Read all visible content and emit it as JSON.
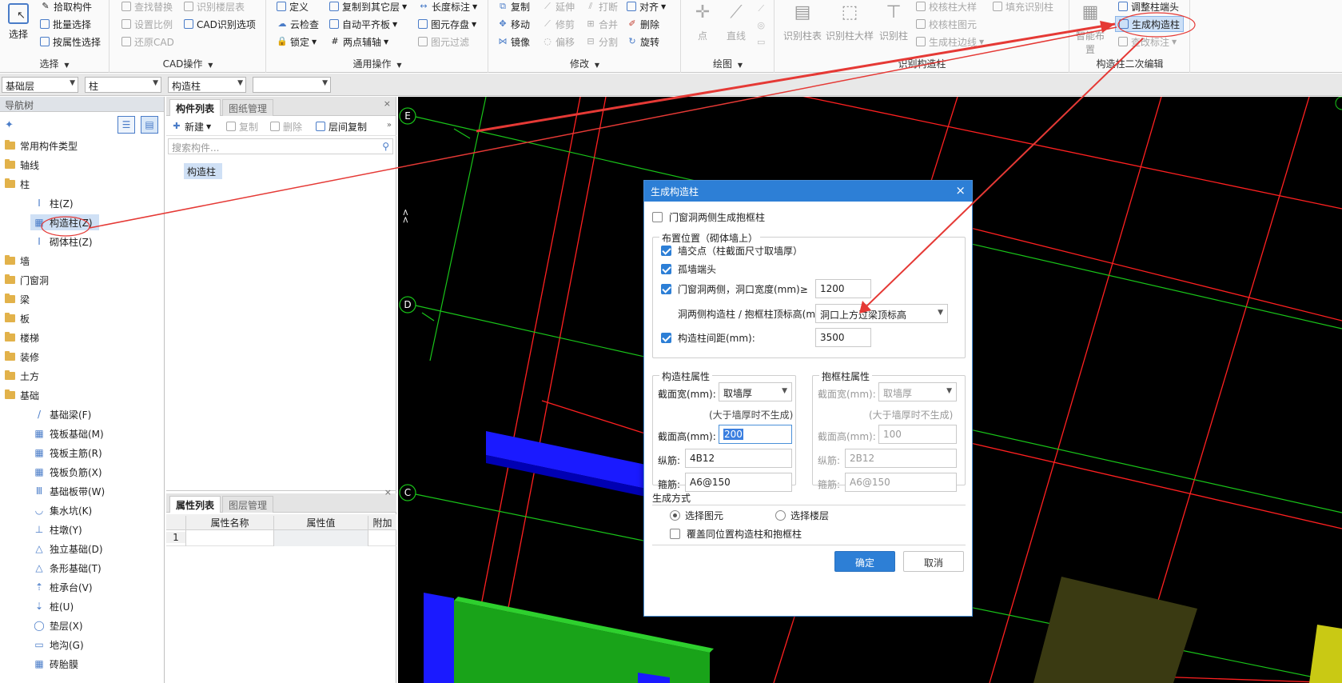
{
  "ribbon": {
    "groups": {
      "select": {
        "label": "选择",
        "big_button": "选择",
        "items": [
          "拾取构件",
          "批量选择",
          "按属性选择"
        ]
      },
      "cad": {
        "label": "CAD操作",
        "items": [
          "查找替换",
          "设置比例",
          "还原CAD",
          "识别楼层表",
          "CAD识别选项"
        ]
      },
      "common": {
        "label": "通用操作",
        "items": [
          "定义",
          "云检查",
          "锁定",
          "复制到其它层",
          "自动平齐板",
          "两点辅轴",
          "长度标注",
          "图元存盘",
          "图元过滤"
        ]
      },
      "modify": {
        "label": "修改",
        "items": [
          "复制",
          "移动",
          "镜像",
          "延伸",
          "修剪",
          "偏移",
          "打断",
          "合并",
          "分割",
          "对齐",
          "删除",
          "旋转"
        ]
      },
      "draw": {
        "label": "绘图",
        "items": [
          "点",
          "直线"
        ]
      },
      "identify": {
        "label": "识别构造柱",
        "items": [
          "识别柱表",
          "识别柱大样",
          "识别柱",
          "校核柱大样",
          "校核柱图元",
          "生成柱边线",
          "填充识别柱"
        ]
      },
      "edit2": {
        "label": "构造柱二次编辑",
        "items": [
          "智能布置",
          "调整柱端头",
          "生成构造柱",
          "查改标注"
        ]
      }
    }
  },
  "toolbar2": {
    "floor": "基础层",
    "category": "柱",
    "type": "构造柱",
    "extra": ""
  },
  "nav": {
    "title": "导航树",
    "items": [
      {
        "label": "常用构件类型",
        "kind": "folder"
      },
      {
        "label": "轴线",
        "kind": "folder"
      },
      {
        "label": "柱",
        "kind": "folder"
      },
      {
        "label": "柱(Z)",
        "kind": "sub",
        "icon": "I"
      },
      {
        "label": "构造柱(Z)",
        "kind": "sub",
        "icon": "▦"
      },
      {
        "label": "砌体柱(Z)",
        "kind": "sub",
        "icon": "I"
      },
      {
        "label": "墙",
        "kind": "folder"
      },
      {
        "label": "门窗洞",
        "kind": "folder"
      },
      {
        "label": "梁",
        "kind": "folder"
      },
      {
        "label": "板",
        "kind": "folder"
      },
      {
        "label": "楼梯",
        "kind": "folder"
      },
      {
        "label": "装修",
        "kind": "folder"
      },
      {
        "label": "土方",
        "kind": "folder"
      },
      {
        "label": "基础",
        "kind": "folder"
      },
      {
        "label": "基础梁(F)",
        "kind": "sub",
        "icon": "/"
      },
      {
        "label": "筏板基础(M)",
        "kind": "sub",
        "icon": "▦"
      },
      {
        "label": "筏板主筋(R)",
        "kind": "sub",
        "icon": "▦"
      },
      {
        "label": "筏板负筋(X)",
        "kind": "sub",
        "icon": "▦"
      },
      {
        "label": "基础板带(W)",
        "kind": "sub",
        "icon": "Ⅲ"
      },
      {
        "label": "集水坑(K)",
        "kind": "sub",
        "icon": "◡"
      },
      {
        "label": "柱墩(Y)",
        "kind": "sub",
        "icon": "⊥"
      },
      {
        "label": "独立基础(D)",
        "kind": "sub",
        "icon": "△"
      },
      {
        "label": "条形基础(T)",
        "kind": "sub",
        "icon": "△"
      },
      {
        "label": "桩承台(V)",
        "kind": "sub",
        "icon": "⇡"
      },
      {
        "label": "桩(U)",
        "kind": "sub",
        "icon": "⇣"
      },
      {
        "label": "垫层(X)",
        "kind": "sub",
        "icon": "◯"
      },
      {
        "label": "地沟(G)",
        "kind": "sub",
        "icon": "▭"
      },
      {
        "label": "砖胎膜",
        "kind": "sub",
        "icon": "▦"
      }
    ]
  },
  "component_panel": {
    "tabs": [
      "构件列表",
      "图纸管理"
    ],
    "actions": {
      "new": "新建",
      "copy": "复制",
      "delete": "删除",
      "floor_copy": "层间复制"
    },
    "search_placeholder": "搜索构件...",
    "items": [
      "构造柱"
    ]
  },
  "property_panel": {
    "tabs": [
      "属性列表",
      "图层管理"
    ],
    "columns": [
      "属性名称",
      "属性值",
      "附加"
    ],
    "rows": [
      {
        "index": "1",
        "name": "",
        "value": "",
        "extra": ""
      }
    ]
  },
  "canvas": {
    "axes": [
      "E",
      "D",
      "C"
    ],
    "fragment": "<<"
  },
  "dialog": {
    "title": "生成构造柱",
    "close": "×",
    "opt_door_frame": "门窗洞两侧生成抱框柱",
    "placement_title": "布置位置（砌体墙上）",
    "opt_wall_intersection": "墙交点（柱截面尺寸取墙厚）",
    "opt_isolated_end": "孤墙端头",
    "opt_opening_sides": "门窗洞两侧，洞口宽度(mm)≥",
    "opening_width": "1200",
    "top_elev_label": "洞两侧构造柱 / 抱框柱顶标高(m):",
    "top_elev_value": "洞口上方过梁顶标高",
    "opt_spacing": "构造柱间距(mm):",
    "spacing_value": "3500",
    "gzz": {
      "title": "构造柱属性",
      "width_label": "截面宽(mm):",
      "width_value": "取墙厚",
      "note": "(大于墙厚时不生成)",
      "height_label": "截面高(mm):",
      "height_value": "200",
      "long_label": "纵筋:",
      "long_value": "4B12",
      "stirrup_label": "箍筋:",
      "stirrup_value": "A6@150"
    },
    "bkz": {
      "title": "抱框柱属性",
      "width_label": "截面宽(mm):",
      "width_value": "取墙厚",
      "note": "(大于墙厚时不生成)",
      "height_label": "截面高(mm):",
      "height_value": "100",
      "long_label": "纵筋:",
      "long_value": "2B12",
      "stirrup_label": "箍筋:",
      "stirrup_value": "A6@150"
    },
    "method_title": "生成方式",
    "method_select_elements": "选择图元",
    "method_select_floors": "选择楼层",
    "opt_override": "覆盖同位置构造柱和抱框柱",
    "ok": "确定",
    "cancel": "取消"
  },
  "colors": {
    "accent": "#2d7fd6",
    "annotation": "#e53935",
    "grid_red": "#ff2020",
    "grid_green": "#19c419"
  }
}
